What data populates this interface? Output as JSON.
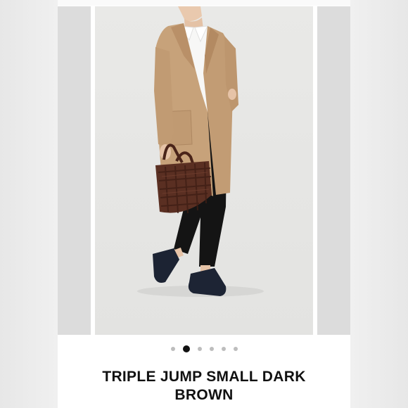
{
  "gallery": {
    "image_alt": "Model wearing beige coat carrying woven dark brown leather basket bag",
    "zoom_icon": "search-icon",
    "slide_count": 6,
    "active_slide": 2
  },
  "product": {
    "title": "TRIPLE JUMP SMALL DARK BROWN"
  },
  "colors": {
    "coat": "#c7a27a",
    "bag": "#5a2f22",
    "background": "#e6e6e4"
  }
}
